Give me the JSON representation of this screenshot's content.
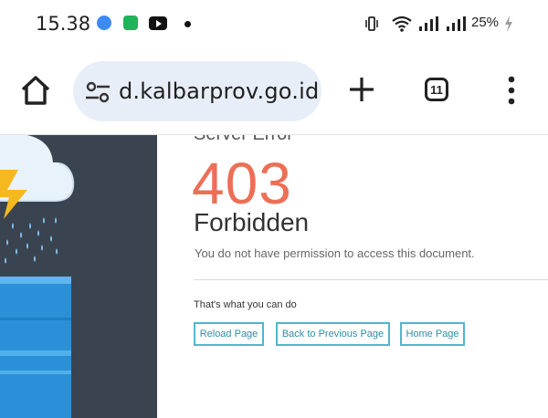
{
  "status_bar": {
    "time": "15.38",
    "battery": "25%",
    "icons": [
      "messenger-app-icon",
      "shopping-app-icon",
      "youtube-app-icon",
      "notification-dot-icon",
      "vibrate-icon",
      "wifi-icon",
      "signal-icon",
      "signal-icon",
      "charging-bolt-icon"
    ]
  },
  "browser": {
    "url": "d.kalbarprov.go.id",
    "tab_count": "11",
    "icons": [
      "home-icon",
      "site-settings-icon",
      "new-tab-plus-icon",
      "tab-switcher-icon",
      "more-menu-icon"
    ]
  },
  "error_page": {
    "subtitle": "Server Error",
    "code": "403",
    "title": "Forbidden",
    "description": "You do not have permission to access this document.",
    "actions_label": "That's what you can do",
    "buttons": [
      "Reload Page",
      "Back to Previous Page",
      "Home Page"
    ]
  },
  "colors": {
    "accent_code": "#ec6f56",
    "button_border": "#50b6cf",
    "illustration_bg": "#3a4451"
  }
}
